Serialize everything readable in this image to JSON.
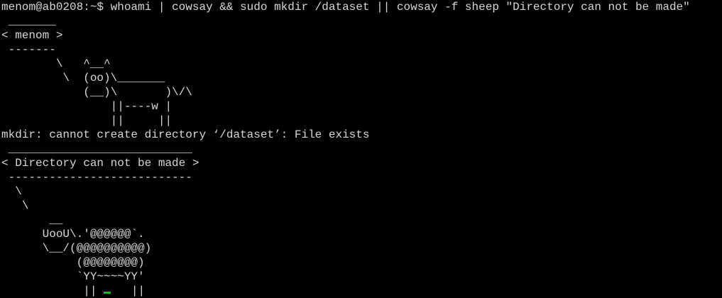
{
  "terminal": {
    "lines": [
      "menom@ab0208:~$ whoami | cowsay && sudo mkdir /dataset || cowsay -f sheep \"Directory can not be made\"",
      " _______",
      "< menom >",
      " -------",
      "        \\   ^__^",
      "         \\  (oo)\\_______",
      "            (__)\\       )\\/\\",
      "                ||----w |",
      "                ||     ||",
      "mkdir: cannot create directory ‘/dataset’: File exists",
      " ___________________________",
      "< Directory can not be made >",
      " ---------------------------",
      "  \\",
      "   \\",
      "       __",
      "      UooU\\.'@@@@@@`.",
      "      \\__/(@@@@@@@@@@)",
      "           (@@@@@@@@)",
      "           `YY~~~~YY'",
      "            ||    ||"
    ],
    "cursor_color": "#00c000",
    "text_color": "#d8d8d8",
    "background_color": "#000000"
  }
}
